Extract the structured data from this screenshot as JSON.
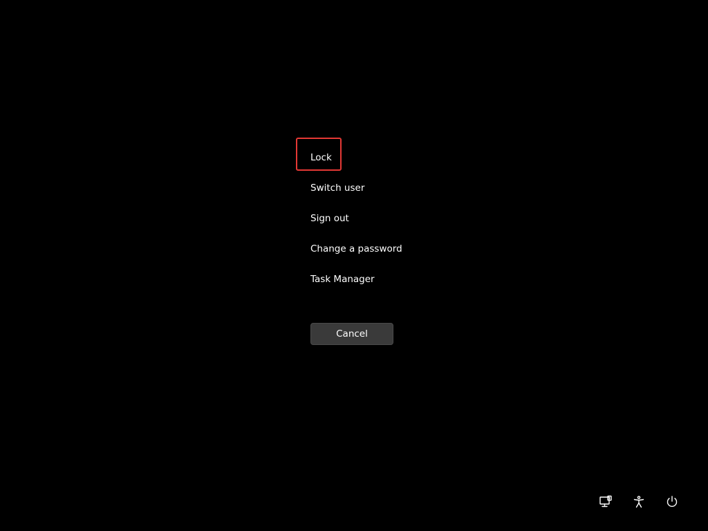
{
  "menu": {
    "items": [
      {
        "label": "Lock",
        "highlighted": true
      },
      {
        "label": "Switch user"
      },
      {
        "label": "Sign out"
      },
      {
        "label": "Change a password"
      },
      {
        "label": "Task Manager"
      }
    ]
  },
  "cancel_button": {
    "label": "Cancel"
  },
  "tray": {
    "icons": [
      "network-icon",
      "accessibility-icon",
      "power-icon"
    ]
  },
  "colors": {
    "background": "#000000",
    "text": "#ffffff",
    "button_bg": "#3a3a3a",
    "highlight_border": "#e53935"
  }
}
